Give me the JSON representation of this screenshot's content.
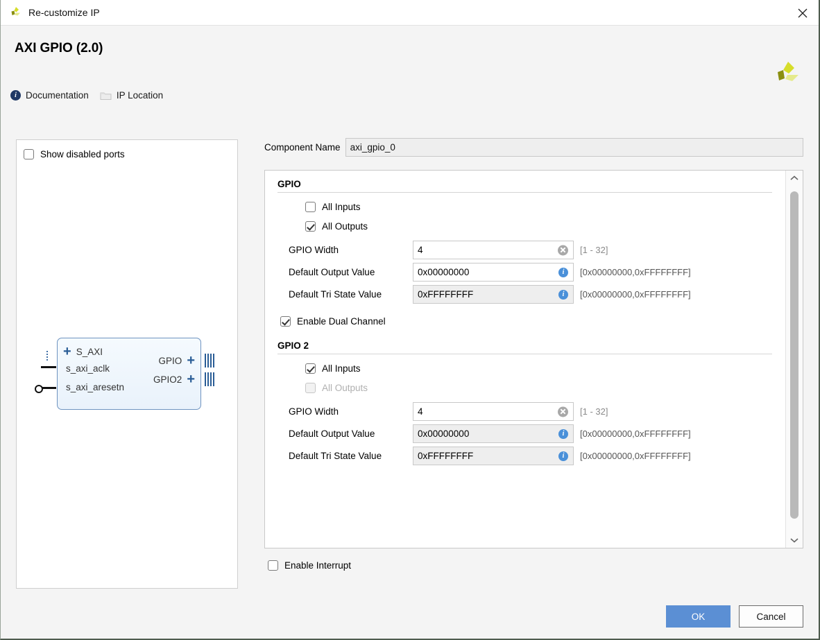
{
  "window": {
    "title": "Re-customize IP",
    "logo_icon": "xilinx-logo-icon",
    "close_icon": "close-icon"
  },
  "header": {
    "ip_title": "AXI GPIO (2.0)",
    "brand_logo_icon": "xilinx-logo-icon",
    "links": [
      {
        "label": "Documentation",
        "icon": "info-icon"
      },
      {
        "label": "IP Location",
        "icon": "folder-icon"
      }
    ]
  },
  "preview": {
    "show_disabled_ports": {
      "label": "Show disabled ports",
      "checked": false
    },
    "block": {
      "left_ports": [
        {
          "label": "S_AXI",
          "marker": "plus"
        },
        {
          "label": "s_axi_aclk",
          "marker": "pin"
        },
        {
          "label": "s_axi_aresetn",
          "marker": "pin-inverted"
        }
      ],
      "right_ports": [
        {
          "label": "GPIO",
          "marker": "plus"
        },
        {
          "label": "GPIO2",
          "marker": "plus"
        }
      ]
    }
  },
  "config": {
    "component_name": {
      "label": "Component Name",
      "value": "axi_gpio_0",
      "placeholder": "axi_gpio_0"
    },
    "sections": [
      {
        "title": "GPIO",
        "checkboxes": [
          {
            "label": "All Inputs",
            "checked": false,
            "disabled": false
          },
          {
            "label": "All Outputs",
            "checked": true,
            "disabled": false
          }
        ],
        "fields": [
          {
            "label": "GPIO Width",
            "value": "4",
            "range": "[1 - 32]",
            "range_dim": true,
            "icon": "clear-icon",
            "disabled": false
          },
          {
            "label": "Default Output Value",
            "value": "0x00000000",
            "range": "[0x00000000,0xFFFFFFFF]",
            "range_dim": false,
            "icon": "info-icon",
            "disabled": false
          },
          {
            "label": "Default Tri State Value",
            "value": "0xFFFFFFFF",
            "range": "[0x00000000,0xFFFFFFFF]",
            "range_dim": false,
            "icon": "info-icon",
            "disabled": true
          }
        ]
      },
      {
        "title": "GPIO 2",
        "checkboxes": [
          {
            "label": "All Inputs",
            "checked": true,
            "disabled": false
          },
          {
            "label": "All Outputs",
            "checked": false,
            "disabled": true
          }
        ],
        "fields": [
          {
            "label": "GPIO Width",
            "value": "4",
            "range": "[1 - 32]",
            "range_dim": true,
            "icon": "clear-icon",
            "disabled": false
          },
          {
            "label": "Default Output Value",
            "value": "0x00000000",
            "range": "[0x00000000,0xFFFFFFFF]",
            "range_dim": false,
            "icon": "info-icon",
            "disabled": true
          },
          {
            "label": "Default Tri State Value",
            "value": "0xFFFFFFFF",
            "range": "[0x00000000,0xFFFFFFFF]",
            "range_dim": false,
            "icon": "info-icon",
            "disabled": true
          }
        ]
      }
    ],
    "enable_dual_channel": {
      "label": "Enable Dual Channel",
      "checked": true
    },
    "enable_interrupt": {
      "label": "Enable Interrupt",
      "checked": false
    },
    "scrollbar": {
      "up_icon": "chevron-up-icon",
      "down_icon": "chevron-down-icon"
    }
  },
  "footer": {
    "ok_label": "OK",
    "cancel_label": "Cancel"
  },
  "colors": {
    "accent_blue": "#5b8fd4",
    "info_blue": "#4a90d9",
    "brand_navy": "#1f3864",
    "block_border": "#6e93c0"
  }
}
